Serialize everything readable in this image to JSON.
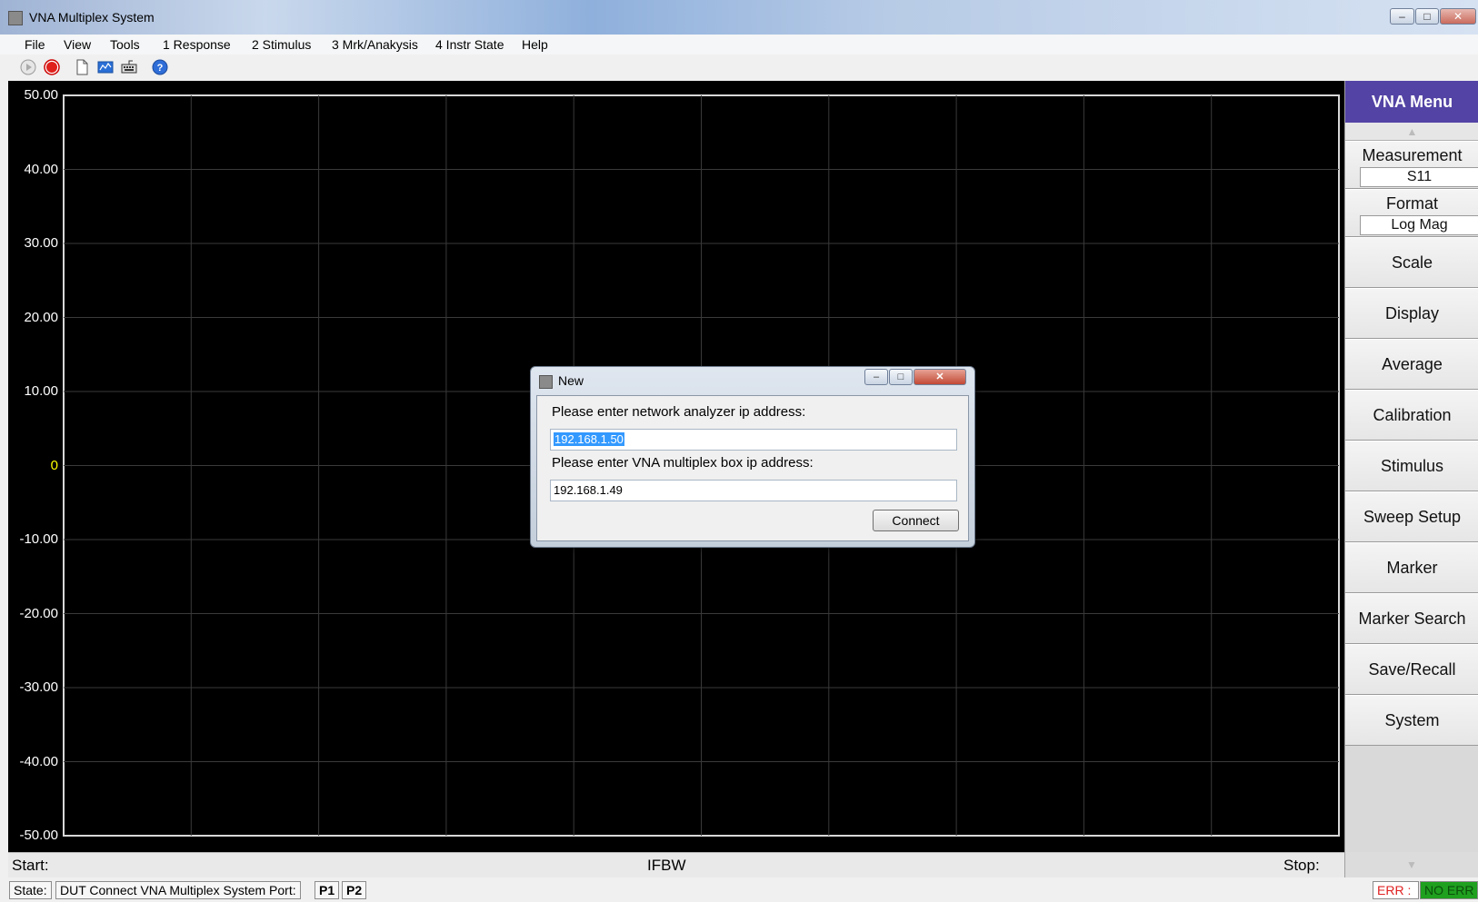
{
  "window": {
    "title": "VNA Multiplex System",
    "min_glyph": "–",
    "max_glyph": "□",
    "close_glyph": "✕"
  },
  "menu": [
    "File",
    "View",
    "Tools",
    "1 Response",
    "2 Stimulus",
    "3 Mrk/Anakysis",
    "4 Instr State",
    "Help"
  ],
  "toolbar": {
    "icons": [
      "play-icon",
      "stop-icon",
      "new-file-icon",
      "chart-icon",
      "keyboard-icon",
      "help-icon"
    ]
  },
  "plot": {
    "y_ticks": [
      "50.00",
      "40.00",
      "30.00",
      "20.00",
      "10.00",
      "0",
      "-10.00",
      "-20.00",
      "-30.00",
      "-40.00",
      "-50.00"
    ],
    "zero_label_color": "#ffff00",
    "tick_label_color": "#ffffff",
    "grid_color": "#3a3a3a",
    "background": "#000000",
    "v_divisions": 10
  },
  "panel": {
    "header": "VNA Menu",
    "measurement": {
      "label": "Measurement",
      "value": "S11"
    },
    "format": {
      "label": "Format",
      "value": "Log Mag"
    },
    "buttons": [
      "Scale",
      "Display",
      "Average",
      "Calibration",
      "Stimulus",
      "Sweep Setup",
      "Marker",
      "Marker Search",
      "Save/Recall",
      "System"
    ],
    "header_color": "#5343a4"
  },
  "status1": {
    "start": "Start:",
    "ifbw": "IFBW",
    "stop": "Stop:"
  },
  "status2": {
    "state_label": "State:",
    "state_text": "DUT Connect VNA Multiplex System Port:",
    "port1": "P1",
    "port2": "P2",
    "err_label": "ERR :",
    "err_value": "NO ERR"
  },
  "dialog": {
    "title": "New",
    "prompt_analyzer": "Please enter network analyzer ip address:",
    "analyzer_ip": "192.168.1.50",
    "prompt_box": "Please enter VNA multiplex box ip address:",
    "box_ip": "192.168.1.49",
    "connect_label": "Connect"
  }
}
